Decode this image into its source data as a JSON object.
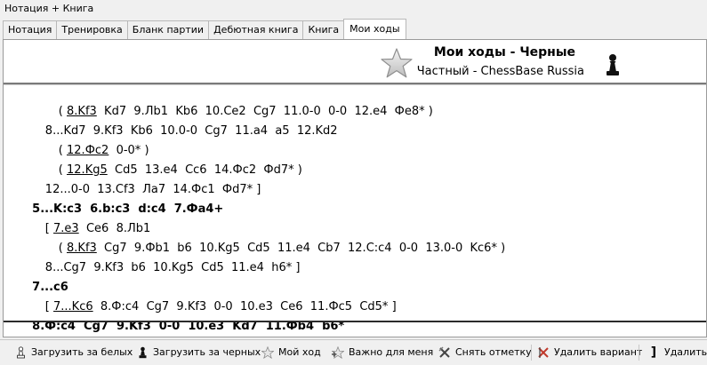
{
  "window": {
    "title": "Нотация + Книга"
  },
  "tabs": [
    {
      "label": "Нотация"
    },
    {
      "label": "Тренировка"
    },
    {
      "label": "Бланк партии"
    },
    {
      "label": "Дебютная книга"
    },
    {
      "label": "Книга"
    },
    {
      "label": "Мои ходы",
      "active": true
    }
  ],
  "header": {
    "title": "Мои ходы - Черные",
    "subtitle": "Частный - ChessBase Russia",
    "star_icon": "star-icon",
    "pawn_icon": "black-pawn-icon"
  },
  "notation": {
    "lines": [
      {
        "indent": "37",
        "parts": [
          {
            "t": "( "
          },
          {
            "t": "8.Kf3",
            "u": true
          },
          {
            "t": "  Kd7  9.Лb1  Kb6  10.Ce2  Cg7  11.0-0  0-0  12.e4  Фe8* )"
          }
        ]
      },
      {
        "indent": "22",
        "parts": [
          {
            "t": "8...Kd7  9.Kf3  Kb6  10.0-0  Cg7  11.a4  a5  12.Kd2"
          }
        ]
      },
      {
        "indent": "37",
        "parts": [
          {
            "t": "( "
          },
          {
            "t": "12.Фc2",
            "u": true
          },
          {
            "t": "  0-0* )"
          }
        ]
      },
      {
        "indent": "37",
        "parts": [
          {
            "t": "( "
          },
          {
            "t": "12.Kg5",
            "u": true
          },
          {
            "t": "  Cd5  13.e4  Cc6  14.Фc2  Фd7* )"
          }
        ]
      },
      {
        "indent": "22",
        "parts": [
          {
            "t": "12...0-0  13.Cf3  Лa7  14.Фc1  Фd7* ]"
          }
        ]
      },
      {
        "indent": "5",
        "bold": true,
        "parts": [
          {
            "t": "5...K:c3  6.b:c3  d:c4  7.Фa4+"
          }
        ]
      },
      {
        "indent": "22",
        "parts": [
          {
            "t": "[ "
          },
          {
            "t": "7.e3",
            "u": true
          },
          {
            "t": "  Ce6  8.Лb1"
          }
        ]
      },
      {
        "indent": "37",
        "parts": [
          {
            "t": "( "
          },
          {
            "t": "8.Kf3",
            "u": true
          },
          {
            "t": "  Cg7  9.Фb1  b6  10.Kg5  Cd5  11.e4  Cb7  12.C:c4  0-0  13.0-0  Kc6* )"
          }
        ]
      },
      {
        "indent": "22",
        "parts": [
          {
            "t": "8...Cg7  9.Kf3  b6  10.Kg5  Cd5  11.e4  h6* ]"
          }
        ]
      },
      {
        "indent": "5",
        "bold": true,
        "parts": [
          {
            "t": "7...c6"
          }
        ]
      },
      {
        "indent": "22",
        "parts": [
          {
            "t": "[ "
          },
          {
            "t": "7...Kc6",
            "u": true
          },
          {
            "t": "  8.Ф:c4  Cg7  9.Kf3  0-0  10.e3  Ce6  11.Фc5  Cd5* ]"
          }
        ]
      },
      {
        "indent": "5",
        "bold": true,
        "parts": [
          {
            "t": "8.Ф:c4  Cg7  9.Kf3  0-0  10.e3  Kd7  11.Фb4  b6*"
          }
        ]
      }
    ]
  },
  "toolbar": {
    "load_white": {
      "label": "Загрузить за белых",
      "icon": "white-pawn-icon"
    },
    "load_black": {
      "label": "Загрузить за черных",
      "icon": "black-pawn-icon"
    },
    "my_move": {
      "label": "Мой ход",
      "icon": "star-icon"
    },
    "important": {
      "label": "Важно для меня",
      "icon": "star-plus-icon"
    },
    "remove_mark": {
      "label": "Снять отметку",
      "icon": "remove-mark-icon"
    },
    "delete_variation": {
      "label": "Удалить вариант",
      "icon": "delete-variation-icon"
    },
    "delete_rest": {
      "label": "Удалить с",
      "icon": "bracket-icon"
    }
  }
}
